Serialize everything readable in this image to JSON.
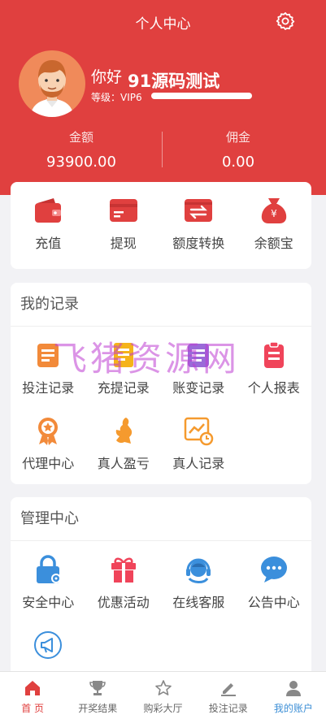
{
  "header": {
    "title": "个人中心",
    "greeting": "你好",
    "username": "91源码测试",
    "level": "等级：VIP6",
    "balance_label": "金额",
    "balance_value": "93900.00",
    "commission_label": "佣金",
    "commission_value": "0.00"
  },
  "wallet": {
    "items": [
      {
        "label": "充值",
        "icon": "wallet-icon"
      },
      {
        "label": "提现",
        "icon": "card-icon"
      },
      {
        "label": "额度转换",
        "icon": "transfer-icon"
      },
      {
        "label": "余额宝",
        "icon": "money-bag-icon"
      }
    ]
  },
  "records": {
    "title": "我的记录",
    "items": [
      {
        "label": "投注记录",
        "icon": "bet-record-icon"
      },
      {
        "label": "充提记录",
        "icon": "deposit-record-icon"
      },
      {
        "label": "账变记录",
        "icon": "account-change-icon"
      },
      {
        "label": "个人报表",
        "icon": "report-icon"
      },
      {
        "label": "代理中心",
        "icon": "agent-medal-icon"
      },
      {
        "label": "真人盈亏",
        "icon": "live-profit-icon"
      },
      {
        "label": "真人记录",
        "icon": "live-record-icon"
      }
    ]
  },
  "management": {
    "title": "管理中心",
    "items": [
      {
        "label": "安全中心",
        "icon": "lock-icon"
      },
      {
        "label": "优惠活动",
        "icon": "gift-icon"
      },
      {
        "label": "在线客服",
        "icon": "customer-service-icon"
      },
      {
        "label": "公告中心",
        "icon": "chat-icon"
      },
      {
        "label": "",
        "icon": "megaphone-icon"
      }
    ]
  },
  "watermark": "飞猪资源网",
  "nav": {
    "items": [
      {
        "label": "首 页",
        "icon": "home-icon",
        "active": true
      },
      {
        "label": "开奖结果",
        "icon": "trophy-icon"
      },
      {
        "label": "购彩大厅",
        "icon": "star-icon"
      },
      {
        "label": "投注记录",
        "icon": "pen-icon"
      },
      {
        "label": "我的账户",
        "icon": "user-icon"
      }
    ]
  },
  "colors": {
    "brand": "#e0403f",
    "nav_active": "#e0403f",
    "nav_account": "#3d8fd6"
  }
}
